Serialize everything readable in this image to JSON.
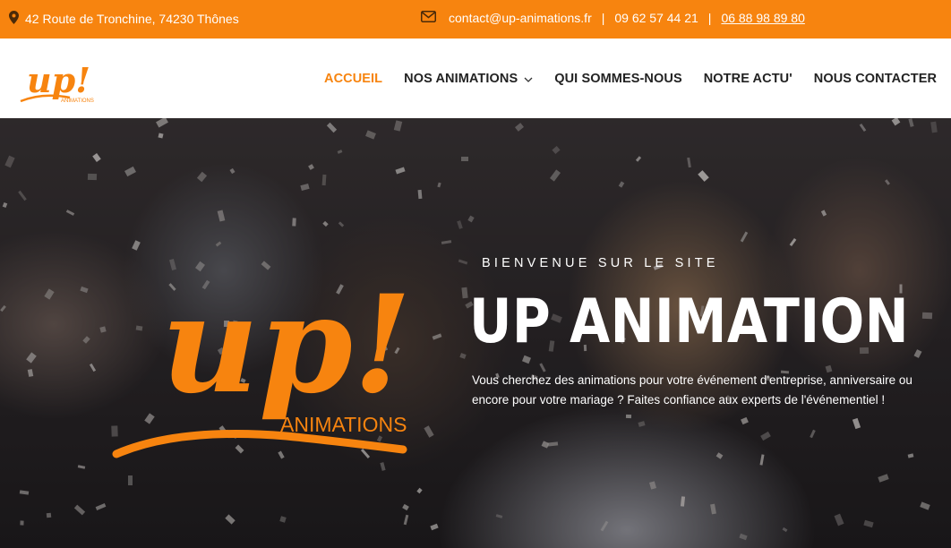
{
  "topbar": {
    "address": "42 Route de Tronchine, 74230 Thônes",
    "email": "contact@up-animations.fr",
    "phone1": "09 62 57 44 21",
    "phone2": "06 88 98 89 80",
    "address_icon": "map-pin-icon",
    "email_icon": "envelope-icon"
  },
  "logo": {
    "main": "up!",
    "sub": "ANIMATIONS"
  },
  "nav": {
    "items": [
      {
        "label": "ACCUEIL",
        "active": true
      },
      {
        "label": "NOS ANIMATIONS",
        "has_dropdown": true
      },
      {
        "label": "QUI SOMMES-NOUS"
      },
      {
        "label": "NOTRE ACTU'"
      },
      {
        "label": "NOUS CONTACTER"
      }
    ]
  },
  "hero": {
    "logo_main": "up!",
    "logo_sub": "ANIMATIONS",
    "welcome": "BIENVENUE SUR LE SITE",
    "title": "UP ANIMATION",
    "description_line1": "Vous cherchez des animations pour votre événement d'entreprise, anniversaire ou",
    "description_line2": "encore pour votre mariage ? Faites confiance aux experts de l'événementiel !"
  },
  "colors": {
    "accent": "#f7840f",
    "nav_text": "#222222",
    "white": "#ffffff"
  }
}
